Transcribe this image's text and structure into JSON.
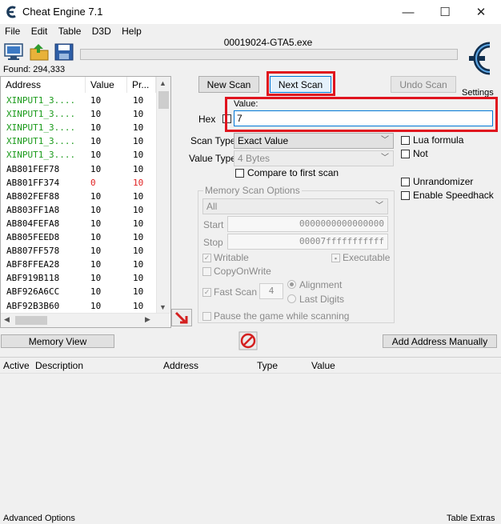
{
  "window": {
    "title": "Cheat Engine 7.1",
    "controls": [
      "—",
      "☐",
      "✕"
    ]
  },
  "menu": [
    "File",
    "Edit",
    "Table",
    "D3D",
    "Help"
  ],
  "process_name": "00019024-GTA5.exe",
  "found_label": "Found: 294,333",
  "results_list": {
    "columns": [
      "Address",
      "Value",
      "Pr..."
    ],
    "rows": [
      {
        "address": "XINPUT1_3....",
        "value": "10",
        "previous": "10",
        "color": "#1a9a1a"
      },
      {
        "address": "XINPUT1_3....",
        "value": "10",
        "previous": "10",
        "color": "#1a9a1a"
      },
      {
        "address": "XINPUT1_3....",
        "value": "10",
        "previous": "10",
        "color": "#1a9a1a"
      },
      {
        "address": "XINPUT1_3....",
        "value": "10",
        "previous": "10",
        "color": "#1a9a1a"
      },
      {
        "address": "XINPUT1_3....",
        "value": "10",
        "previous": "10",
        "color": "#1a9a1a"
      },
      {
        "address": "AB801FEF78",
        "value": "10",
        "previous": "10",
        "color": "#000000"
      },
      {
        "address": "AB801FF374",
        "value": "0",
        "previous": "10",
        "color": "#000000",
        "value_color": "#e02020"
      },
      {
        "address": "AB802FEF88",
        "value": "10",
        "previous": "10",
        "color": "#000000"
      },
      {
        "address": "AB803FF1A8",
        "value": "10",
        "previous": "10",
        "color": "#000000"
      },
      {
        "address": "AB804FEFA8",
        "value": "10",
        "previous": "10",
        "color": "#000000"
      },
      {
        "address": "AB805FEED8",
        "value": "10",
        "previous": "10",
        "color": "#000000"
      },
      {
        "address": "AB807FF578",
        "value": "10",
        "previous": "10",
        "color": "#000000"
      },
      {
        "address": "ABF8FFEA28",
        "value": "10",
        "previous": "10",
        "color": "#000000"
      },
      {
        "address": "ABF919B118",
        "value": "10",
        "previous": "10",
        "color": "#000000"
      },
      {
        "address": "ABF926A6CC",
        "value": "10",
        "previous": "10",
        "color": "#000000"
      },
      {
        "address": "ABF92B3B60",
        "value": "10",
        "previous": "10",
        "color": "#000000"
      }
    ]
  },
  "scan": {
    "new_scan": "New Scan",
    "next_scan": "Next Scan",
    "undo_scan": "Undo Scan",
    "settings": "Settings",
    "value_label": "Value:",
    "hex_label": "Hex",
    "value": "7",
    "scan_type_label": "Scan Type",
    "scan_type_value": "Exact Value",
    "value_type_label": "Value Type",
    "value_type_value": "4 Bytes",
    "compare_first": "Compare to first scan",
    "lua_formula": "Lua formula",
    "not_label": "Not",
    "unrandomizer": "Unrandomizer",
    "enable_speedhack": "Enable Speedhack"
  },
  "memory_options": {
    "title": "Memory Scan Options",
    "region_value": "All",
    "start_label": "Start",
    "start_value": "0000000000000000",
    "stop_label": "Stop",
    "stop_value": "00007fffffffffff",
    "writable": "Writable",
    "executable": "Executable",
    "copy_on_write": "CopyOnWrite",
    "fast_scan": "Fast Scan",
    "fast_scan_value": "4",
    "alignment": "Alignment",
    "last_digits": "Last Digits",
    "pause_game": "Pause the game while scanning"
  },
  "buttons": {
    "memory_view": "Memory View",
    "add_address_manually": "Add Address Manually"
  },
  "address_table": {
    "columns": [
      "Active",
      "Description",
      "Address",
      "Type",
      "Value"
    ]
  },
  "status": {
    "left": "Advanced Options",
    "right": "Table Extras"
  },
  "colors": {
    "highlight_red": "#e0141e",
    "accent_blue": "#0078d7"
  }
}
